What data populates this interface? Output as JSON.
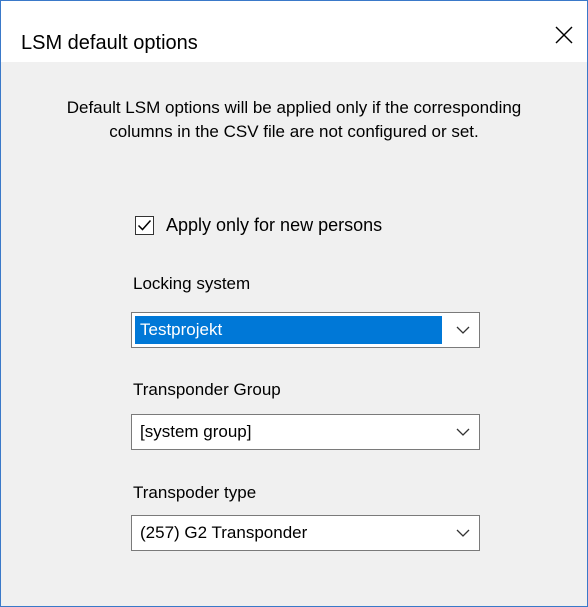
{
  "window": {
    "title": "LSM default options"
  },
  "info_text": "Default LSM options will be applied only if the corresponding columns in the CSV file are not configured or set.",
  "apply_new_persons": {
    "label": "Apply only for new persons",
    "checked": true
  },
  "locking_system": {
    "label": "Locking system",
    "value": "Testprojekt"
  },
  "transponder_group": {
    "label": "Transponder Group",
    "value": "[system group]"
  },
  "transponder_type": {
    "label": "Transpoder type",
    "value": "(257) G2 Transponder"
  },
  "icons": {
    "close": "close-icon",
    "check": "checkmark-icon",
    "dropdown": "chevron-down-icon"
  },
  "colors": {
    "accent": "#0078d7",
    "window_border": "#3a79c9",
    "background": "#f0f0f0"
  }
}
